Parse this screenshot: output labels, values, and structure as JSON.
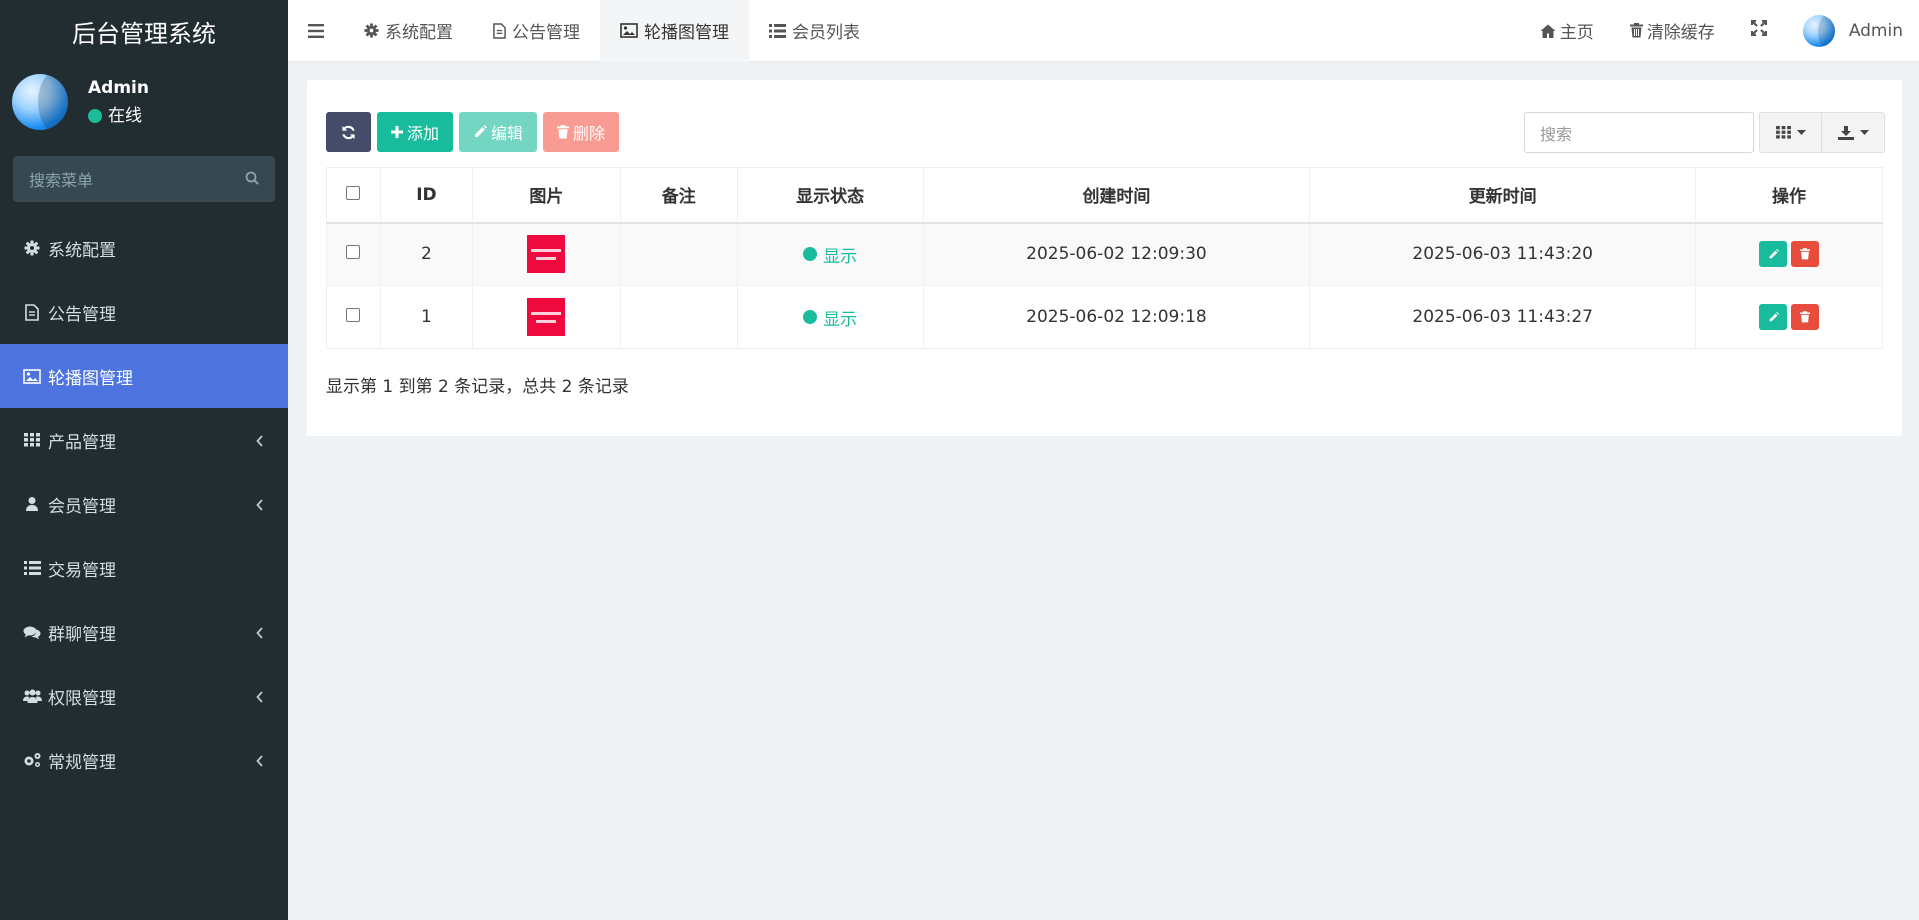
{
  "app": {
    "title": "后台管理系统"
  },
  "user": {
    "name": "Admin",
    "status": "在线"
  },
  "sidebar": {
    "search_placeholder": "搜索菜单",
    "items": [
      {
        "label": "系统配置",
        "icon": "gear-icon",
        "active": false,
        "has_children": false
      },
      {
        "label": "公告管理",
        "icon": "file-icon",
        "active": false,
        "has_children": false
      },
      {
        "label": "轮播图管理",
        "icon": "image-icon",
        "active": true,
        "has_children": false
      },
      {
        "label": "产品管理",
        "icon": "grid-icon",
        "active": false,
        "has_children": true
      },
      {
        "label": "会员管理",
        "icon": "user-icon",
        "active": false,
        "has_children": true
      },
      {
        "label": "交易管理",
        "icon": "list-icon",
        "active": false,
        "has_children": false
      },
      {
        "label": "群聊管理",
        "icon": "comments-icon",
        "active": false,
        "has_children": true
      },
      {
        "label": "权限管理",
        "icon": "group-icon",
        "active": false,
        "has_children": true
      },
      {
        "label": "常规管理",
        "icon": "cogs-icon",
        "active": false,
        "has_children": true
      }
    ]
  },
  "topbar": {
    "tabs": [
      {
        "label": "系统配置",
        "icon": "gear-icon",
        "active": false
      },
      {
        "label": "公告管理",
        "icon": "file-icon",
        "active": false
      },
      {
        "label": "轮播图管理",
        "icon": "image-icon",
        "active": true
      },
      {
        "label": "会员列表",
        "icon": "list-icon",
        "active": false
      }
    ],
    "home_label": "主页",
    "clear_cache_label": "清除缓存",
    "user_label": "Admin"
  },
  "toolbar": {
    "add_label": "添加",
    "edit_label": "编辑",
    "delete_label": "删除",
    "search_placeholder": "搜索"
  },
  "table": {
    "columns": [
      "ID",
      "图片",
      "备注",
      "显示状态",
      "创建时间",
      "更新时间",
      "操作"
    ],
    "rows": [
      {
        "id": "2",
        "remark": "",
        "status": "显示",
        "created": "2025-06-02 12:09:30",
        "updated": "2025-06-03 11:43:20"
      },
      {
        "id": "1",
        "remark": "",
        "status": "显示",
        "created": "2025-06-02 12:09:18",
        "updated": "2025-06-03 11:43:27"
      }
    ],
    "summary": "显示第 1 到第 2 条记录，总共 2 条记录"
  },
  "colors": {
    "sidebar_bg": "#222d32",
    "active_blue": "#4d74de",
    "success": "#18bc9c",
    "danger": "#e74c3c"
  }
}
